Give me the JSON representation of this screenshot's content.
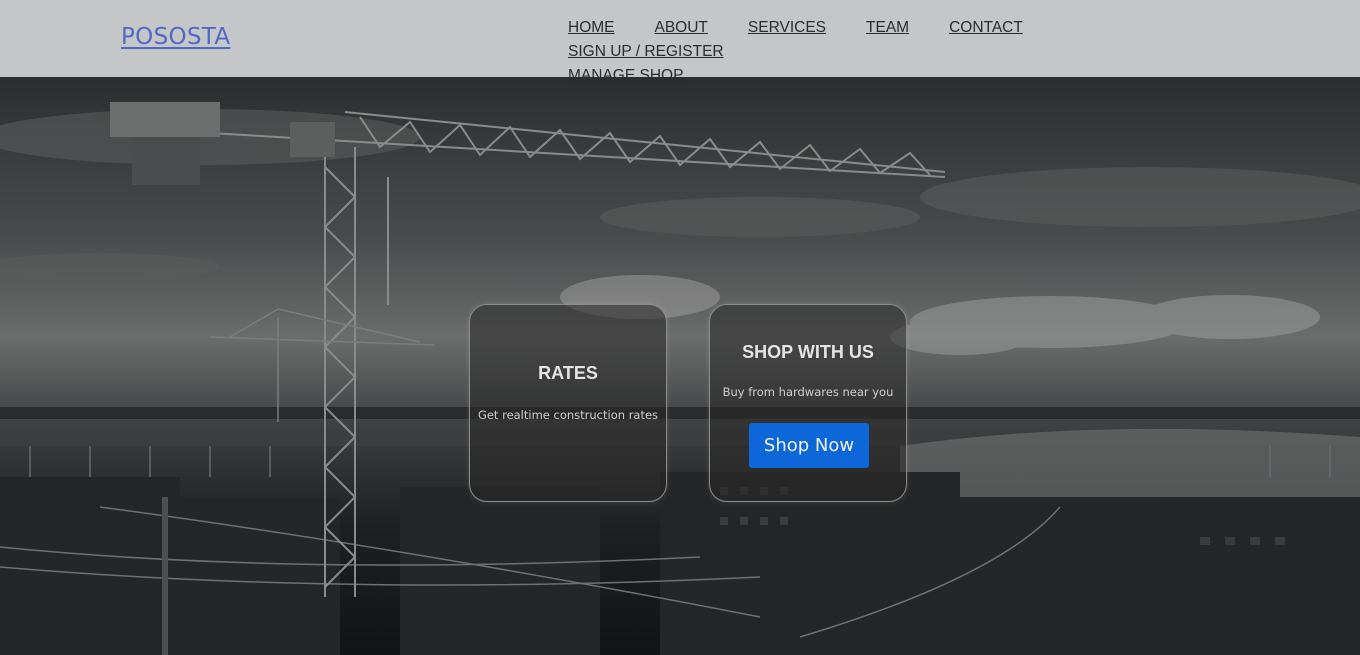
{
  "header": {
    "logo": "POSOSTA",
    "nav": [
      {
        "label": "HOME"
      },
      {
        "label": "ABOUT"
      },
      {
        "label": "SERVICES"
      },
      {
        "label": "TEAM"
      },
      {
        "label": "CONTACT"
      },
      {
        "label": "SIGN UP / REGISTER"
      },
      {
        "label": "MANAGE SHOP"
      }
    ]
  },
  "cards": {
    "rates": {
      "title": "RATES",
      "description": "Get realtime construction rates"
    },
    "shop": {
      "title": "SHOP WITH US",
      "description": "Buy from hardwares near you",
      "button": "Shop Now"
    }
  },
  "colors": {
    "header_bg": "#c5c6c8",
    "logo": "#5069c5",
    "button": "#0d67d8"
  }
}
